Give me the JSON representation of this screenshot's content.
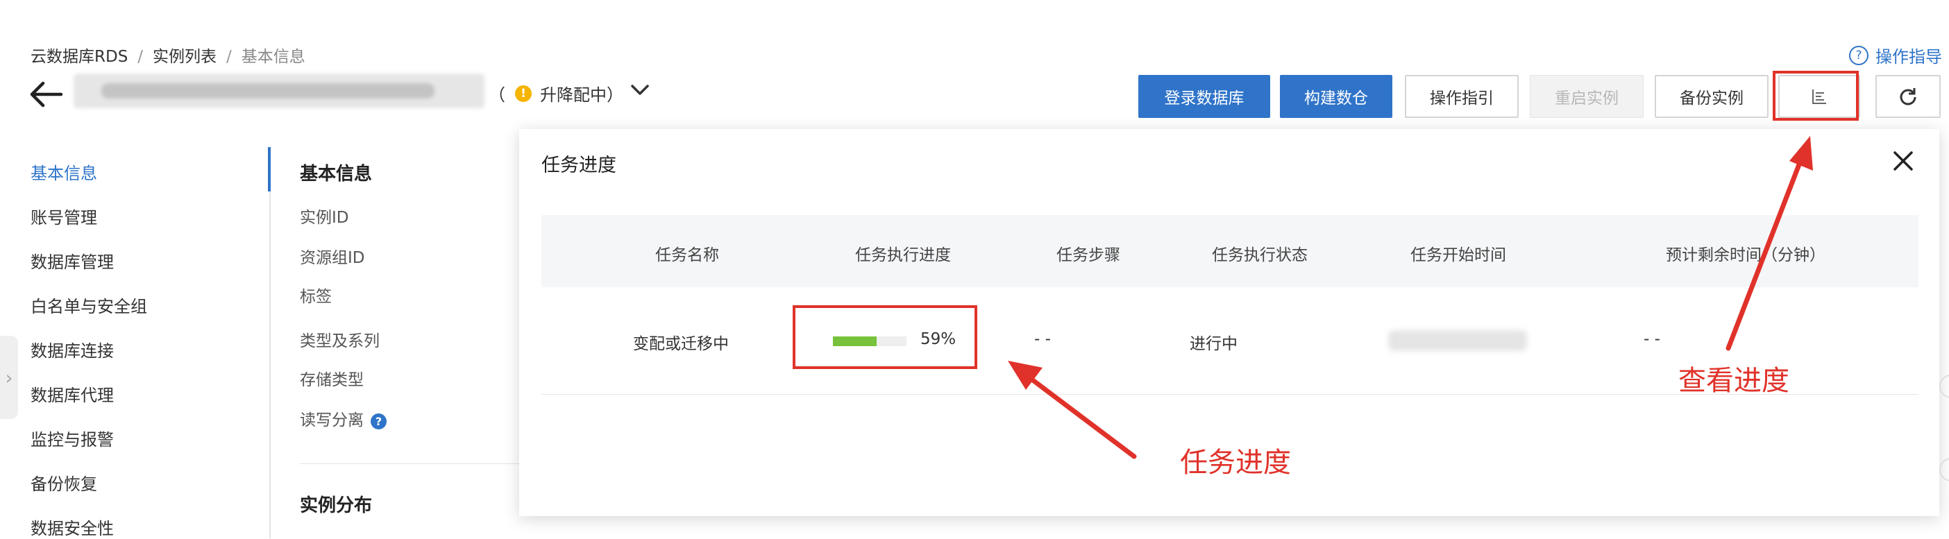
{
  "breadcrumb": [
    "云数据库RDS",
    "实例列表",
    "基本信息"
  ],
  "title": {
    "status_text": "升降配中",
    "paren_open": "（",
    "paren_close": "）",
    "warn_glyph": "!"
  },
  "help": {
    "label": "操作指导",
    "glyph": "?"
  },
  "toolbar": {
    "login_db": "登录数据库",
    "build_warehouse": "构建数仓",
    "operation_guide": "操作指引",
    "restart_instance": "重启实例",
    "backup_instance": "备份实例"
  },
  "sidebar": {
    "items": [
      {
        "label": "基本信息",
        "active": true
      },
      {
        "label": "账号管理"
      },
      {
        "label": "数据库管理"
      },
      {
        "label": "白名单与安全组"
      },
      {
        "label": "数据库连接"
      },
      {
        "label": "数据库代理"
      },
      {
        "label": "监控与报警"
      },
      {
        "label": "备份恢复"
      },
      {
        "label": "数据安全性"
      }
    ],
    "collapse_glyph": "›"
  },
  "info": {
    "heading": "基本信息",
    "labels": [
      "实例ID",
      "资源组ID",
      "标签",
      "类型及系列",
      "存储类型",
      "读写分离"
    ],
    "help_glyph": "?",
    "section2_heading": "实例分布"
  },
  "popover": {
    "title": "任务进度",
    "columns": [
      "任务名称",
      "任务执行进度",
      "任务步骤",
      "任务执行状态",
      "任务开始时间",
      "预计剩余时间（分钟）"
    ],
    "row": {
      "task_name": "变配或迁移中",
      "progress": 0.59,
      "progress_label": "59%",
      "step": "- -",
      "status": "进行中",
      "remaining": "- -"
    }
  },
  "annotations": {
    "progress_label": "任务进度",
    "view_progress_label": "查看进度",
    "color": "#e0322a"
  },
  "colors": {
    "primary": "#2f74c9",
    "progress": "#77c23a",
    "warning": "#f5b400"
  }
}
